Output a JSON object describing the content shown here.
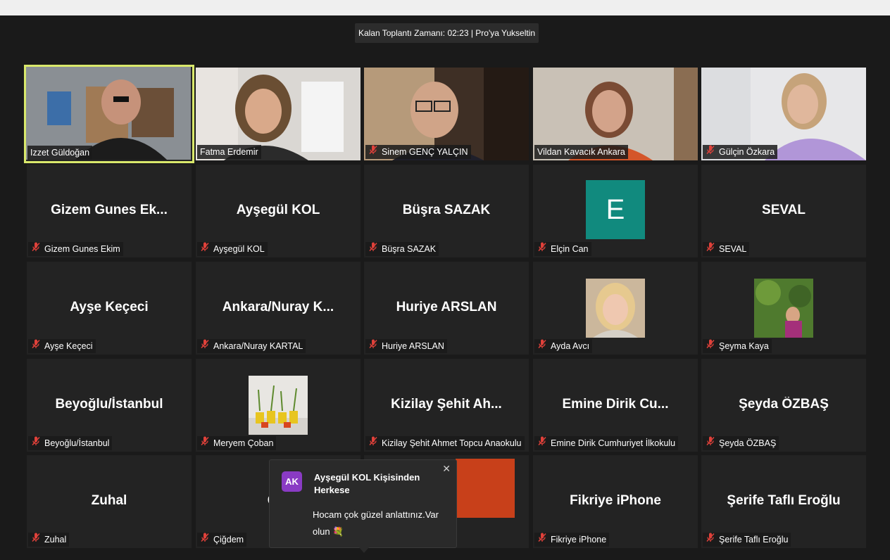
{
  "meeting": {
    "timer_text": "Kalan Toplantı Zamanı: 02:23 | Pro'ya Yukseltin"
  },
  "tiles": [
    {
      "label": "Izzet Güldoğan",
      "big": "",
      "muted": false,
      "video": "v1",
      "active": true
    },
    {
      "label": "Fatma Erdemir",
      "big": "",
      "muted": false,
      "video": "v2"
    },
    {
      "label": "Sinem GENÇ YALÇIN",
      "big": "",
      "muted": true,
      "video": "v3"
    },
    {
      "label": "Vildan Kavacık Ankara",
      "big": "",
      "muted": false,
      "video": "v4"
    },
    {
      "label": "Gülçin Özkara",
      "big": "",
      "muted": true,
      "video": "v5"
    },
    {
      "label": "Gizem Gunes Ekim",
      "big": "Gizem Gunes Ek...",
      "muted": true
    },
    {
      "label": "Ayşegül KOL",
      "big": "Ayşegül KOL",
      "muted": true
    },
    {
      "label": "Büşra SAZAK",
      "big": "Büşra SAZAK",
      "muted": true
    },
    {
      "label": "Elçin  Can",
      "big": "",
      "muted": true,
      "avatar_letter": "E"
    },
    {
      "label": "SEVAL",
      "big": "SEVAL",
      "muted": true
    },
    {
      "label": "Ayşe Keçeci",
      "big": "Ayşe Keçeci",
      "muted": true
    },
    {
      "label": "Ankara/Nuray KARTAL",
      "big": "Ankara/Nuray  K...",
      "muted": true
    },
    {
      "label": "Huriye ARSLAN",
      "big": "Huriye ARSLAN",
      "muted": true
    },
    {
      "label": "Ayda Avcı",
      "big": "",
      "muted": true,
      "avatar_photo": "p1"
    },
    {
      "label": "Şeyma Kaya",
      "big": "",
      "muted": true,
      "avatar_photo": "p2"
    },
    {
      "label": "Beyoğlu/İstanbul",
      "big": "Beyoğlu/İstanbul",
      "muted": true
    },
    {
      "label": "Meryem Çoban",
      "big": "",
      "muted": true,
      "avatar_photo": "p3"
    },
    {
      "label": "Kizilay Şehit Ahmet Topcu Anaokulu",
      "big": "Kizilay  Şehit  Ah...",
      "muted": true
    },
    {
      "label": "Emine Dirik Cumhuriyet İlkokulu",
      "big": "Emine  Dirik  Cu...",
      "muted": true
    },
    {
      "label": "Şeyda ÖZBAŞ",
      "big": "Şeyda ÖZBAŞ",
      "muted": true
    },
    {
      "label": "Zuhal",
      "big": "Zuhal",
      "muted": true
    },
    {
      "label": "Çiğdem",
      "big": "Çiğ",
      "muted": true
    },
    {
      "label": "",
      "big": "",
      "muted": false,
      "avatar_color": "#c8401a"
    },
    {
      "label": "Fikriye iPhone",
      "big": "Fikriye iPhone",
      "muted": true
    },
    {
      "label": "Şerife Taflı Eroğlu",
      "big": "Şerife Taflı Eroğlu",
      "muted": true
    }
  ],
  "chat": {
    "avatar_initials": "AK",
    "title": "Ayşegül KOL Kişisinden Herkese",
    "message": "Hocam çok güzel anlattınız.Var olun",
    "emoji": "💐",
    "close": "✕"
  },
  "colors": {
    "active_border": "#d9e86b",
    "muted_icon": "#e0413a",
    "avatar_letter_bg": "#118a7e",
    "chat_avatar_bg": "#8a3bc4"
  },
  "icons": {
    "mic": "muted-microphone-icon",
    "close": "close-icon"
  }
}
